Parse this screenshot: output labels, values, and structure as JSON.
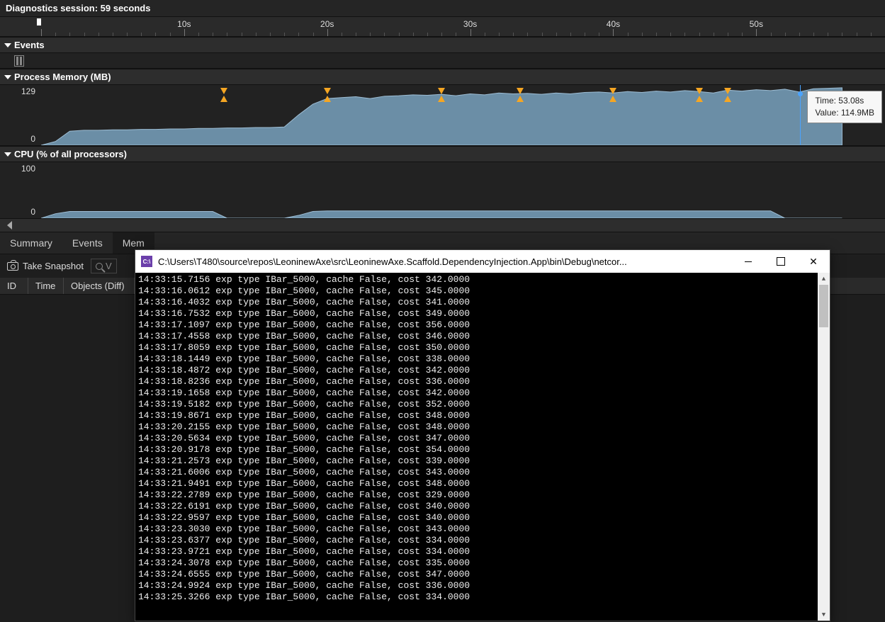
{
  "session": {
    "title": "Diagnostics session: 59 seconds"
  },
  "ruler": {
    "labels": [
      "10s",
      "20s",
      "30s",
      "40s",
      "50s"
    ]
  },
  "sections": {
    "events": "Events",
    "memory": "Process Memory (MB)",
    "cpu": "CPU (% of all processors)"
  },
  "memory": {
    "max_label": "129",
    "min_label": "0",
    "tooltip_time": "Time: 53.08s",
    "tooltip_value": "Value: 114.9MB"
  },
  "cpu": {
    "max_label": "100",
    "min_label": "0"
  },
  "tabs": {
    "summary": "Summary",
    "events": "Events",
    "memory": "Mem"
  },
  "toolbar": {
    "snapshot": "Take Snapshot",
    "search_placeholder": "V"
  },
  "table_cols": {
    "id": "ID",
    "time": "Time",
    "objects": "Objects (Diff)"
  },
  "console": {
    "title": "C:\\Users\\T480\\source\\repos\\LeoninewAxe\\src\\LeoninewAxe.Scaffold.DependencyInjection.App\\bin\\Debug\\netcor...",
    "lines": [
      "14:33:15.7156 exp type IBar_5000, cache False, cost 342.0000",
      "14:33:16.0612 exp type IBar_5000, cache False, cost 345.0000",
      "14:33:16.4032 exp type IBar_5000, cache False, cost 341.0000",
      "14:33:16.7532 exp type IBar_5000, cache False, cost 349.0000",
      "14:33:17.1097 exp type IBar_5000, cache False, cost 356.0000",
      "14:33:17.4558 exp type IBar_5000, cache False, cost 346.0000",
      "14:33:17.8059 exp type IBar_5000, cache False, cost 350.0000",
      "14:33:18.1449 exp type IBar_5000, cache False, cost 338.0000",
      "14:33:18.4872 exp type IBar_5000, cache False, cost 342.0000",
      "14:33:18.8236 exp type IBar_5000, cache False, cost 336.0000",
      "14:33:19.1658 exp type IBar_5000, cache False, cost 342.0000",
      "14:33:19.5182 exp type IBar_5000, cache False, cost 352.0000",
      "14:33:19.8671 exp type IBar_5000, cache False, cost 348.0000",
      "14:33:20.2155 exp type IBar_5000, cache False, cost 348.0000",
      "14:33:20.5634 exp type IBar_5000, cache False, cost 347.0000",
      "14:33:20.9178 exp type IBar_5000, cache False, cost 354.0000",
      "14:33:21.2573 exp type IBar_5000, cache False, cost 339.0000",
      "14:33:21.6006 exp type IBar_5000, cache False, cost 343.0000",
      "14:33:21.9491 exp type IBar_5000, cache False, cost 348.0000",
      "14:33:22.2789 exp type IBar_5000, cache False, cost 329.0000",
      "14:33:22.6191 exp type IBar_5000, cache False, cost 340.0000",
      "14:33:22.9597 exp type IBar_5000, cache False, cost 340.0000",
      "14:33:23.3030 exp type IBar_5000, cache False, cost 343.0000",
      "14:33:23.6377 exp type IBar_5000, cache False, cost 334.0000",
      "14:33:23.9721 exp type IBar_5000, cache False, cost 334.0000",
      "14:33:24.3078 exp type IBar_5000, cache False, cost 335.0000",
      "14:33:24.6555 exp type IBar_5000, cache False, cost 347.0000",
      "14:33:24.9924 exp type IBar_5000, cache False, cost 336.0000",
      "14:33:25.3266 exp type IBar_5000, cache False, cost 334.0000"
    ]
  },
  "chart_data": [
    {
      "type": "area",
      "title": "Process Memory (MB)",
      "ylabel": "MB",
      "ylim": [
        0,
        129
      ],
      "xlim": [
        0,
        59
      ],
      "x": [
        0,
        1,
        2,
        3,
        4,
        5,
        6,
        7,
        8,
        9,
        10,
        11,
        12,
        13,
        14,
        15,
        16,
        17,
        18,
        19,
        20,
        21,
        22,
        23,
        24,
        25,
        26,
        27,
        28,
        29,
        30,
        31,
        32,
        33,
        34,
        35,
        36,
        37,
        38,
        39,
        40,
        41,
        42,
        43,
        44,
        45,
        46,
        47,
        48,
        49,
        50,
        51,
        52,
        53,
        54,
        55,
        56
      ],
      "values": [
        0,
        8,
        30,
        32,
        32,
        33,
        33,
        34,
        34,
        35,
        35,
        36,
        36,
        37,
        37,
        38,
        38,
        39,
        65,
        88,
        100,
        102,
        104,
        100,
        105,
        106,
        108,
        107,
        109,
        106,
        110,
        108,
        112,
        110,
        111,
        109,
        112,
        110,
        113,
        114,
        112,
        115,
        113,
        116,
        114,
        117,
        115,
        112,
        118,
        116,
        119,
        117,
        120,
        114,
        121,
        122,
        123
      ],
      "gc_markers_x": [
        12.8,
        20,
        28,
        33.5,
        40,
        46,
        48
      ]
    },
    {
      "type": "area",
      "title": "CPU (% of all processors)",
      "ylabel": "%",
      "ylim": [
        0,
        100
      ],
      "xlim": [
        0,
        59
      ],
      "x": [
        0,
        1,
        2,
        3,
        4,
        5,
        6,
        7,
        8,
        9,
        10,
        11,
        12,
        13,
        14,
        15,
        16,
        17,
        18,
        19,
        20,
        21,
        22,
        23,
        24,
        25,
        26,
        27,
        28,
        29,
        30,
        31,
        32,
        33,
        34,
        35,
        36,
        37,
        38,
        39,
        40,
        41,
        42,
        43,
        44,
        45,
        46,
        47,
        48,
        49,
        50,
        51,
        52,
        53,
        54,
        55,
        56
      ],
      "values": [
        0,
        8,
        12,
        12,
        12,
        12,
        12,
        12,
        12,
        12,
        12,
        12,
        12,
        0,
        0,
        0,
        0,
        0,
        5,
        12,
        13,
        13,
        13,
        13,
        13,
        13,
        13,
        13,
        13,
        13,
        13,
        13,
        13,
        13,
        13,
        13,
        13,
        13,
        13,
        13,
        13,
        13,
        13,
        13,
        13,
        13,
        13,
        13,
        13,
        13,
        13,
        13,
        0,
        0,
        0,
        0,
        0
      ]
    }
  ]
}
